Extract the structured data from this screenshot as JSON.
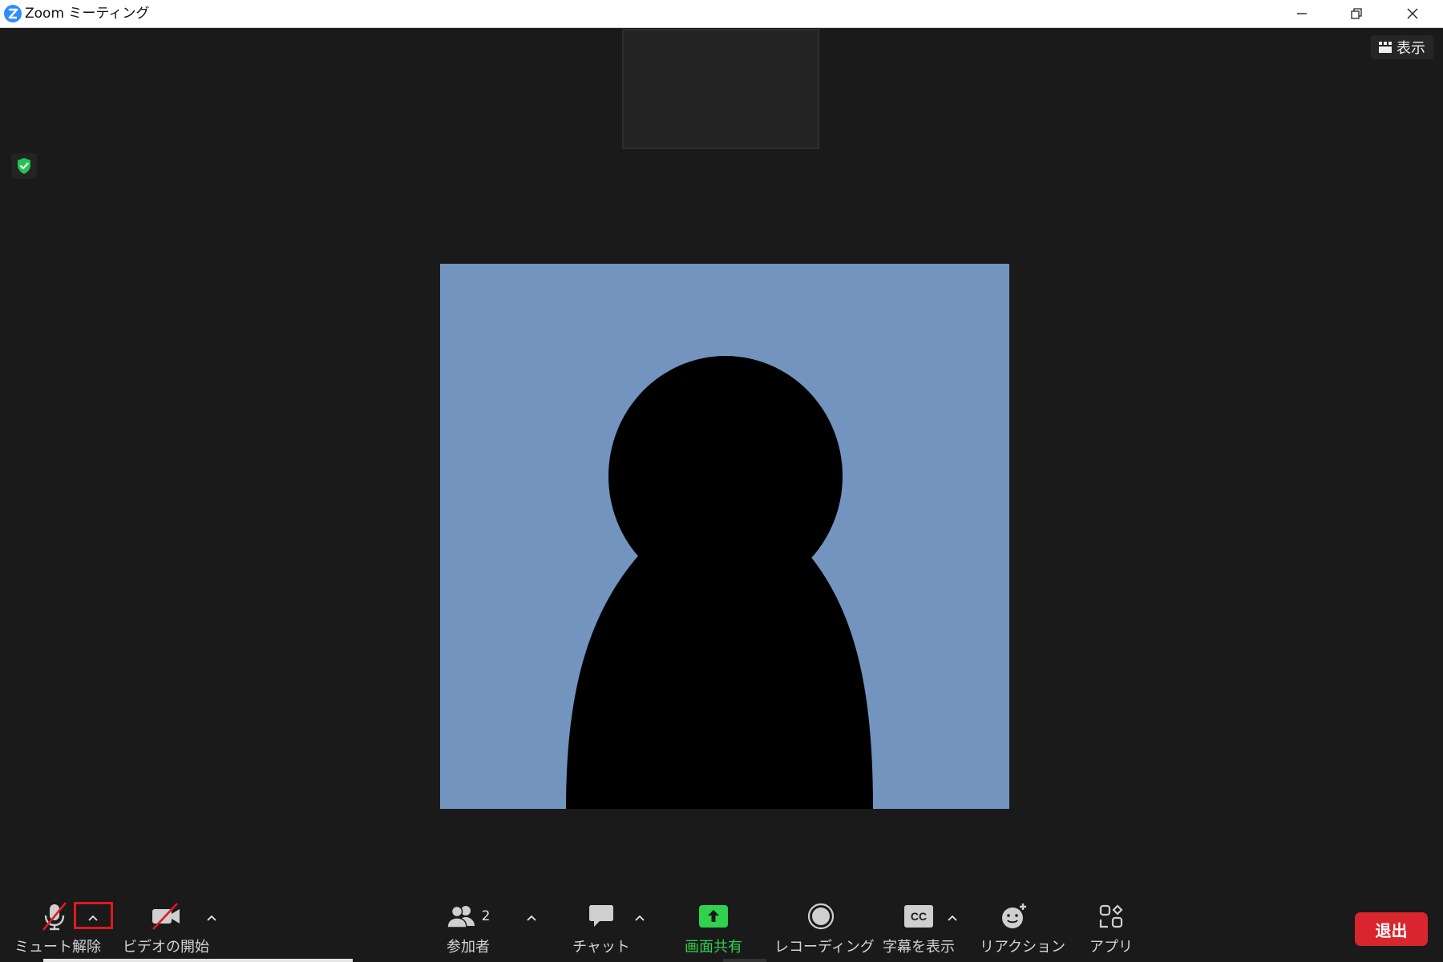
{
  "window": {
    "title": "Zoom ミーティング",
    "minimize_icon": "minimize-icon",
    "maximize_icon": "restore-icon",
    "close_icon": "close-icon"
  },
  "stage": {
    "view_button_label": "表示",
    "security_icon": "shield-check-icon",
    "participant_avatar": "person-silhouette",
    "avatar_bg_color": "#7294be"
  },
  "toolbar": {
    "mute_label": "ミュート解除",
    "video_label": "ビデオの開始",
    "participants_label": "参加者",
    "participants_count": "2",
    "chat_label": "チャット",
    "share_label": "画面共有",
    "record_label": "レコーディング",
    "captions_label": "字幕を表示",
    "reactions_label": "リアクション",
    "apps_label": "アプリ",
    "leave_label": "退出"
  },
  "colors": {
    "share_green": "#2fd14d",
    "leave_red": "#d9262e",
    "muted_red": "#e0191f"
  }
}
